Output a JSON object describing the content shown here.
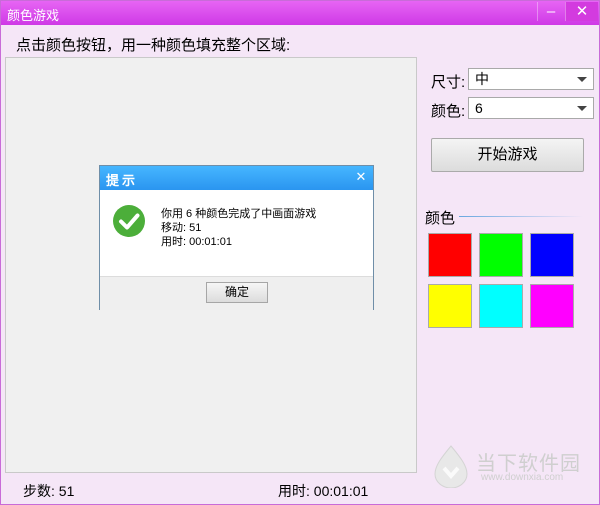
{
  "window": {
    "title": "颜色游戏"
  },
  "instruction": "点击颜色按钮，用一种颜色填充整个区域:",
  "controls": {
    "size_label": "尺寸:",
    "size_value": "中",
    "color_label": "颜色:",
    "color_value": "6",
    "start_button": "开始游戏"
  },
  "palette": {
    "title": "颜色",
    "colors": [
      "#ff0000",
      "#00ff00",
      "#0000ff",
      "#ffff00",
      "#00ffff",
      "#ff00ff"
    ]
  },
  "status": {
    "steps": "步数: 51",
    "time": "用时: 00:01:01"
  },
  "dialog": {
    "title": "提示",
    "message_line1": "你用 6 种颜色完成了中画面游戏",
    "message_line2": "移动: 51",
    "message_line3": "用时: 00:01:01",
    "ok_button": "确定"
  },
  "watermark": {
    "text": "当下软件园",
    "url": "www.downxia.com"
  },
  "colors": {
    "titlebar": "#d94ae9",
    "dialog_title": "#36a6f9",
    "success_icon": "#4cae3a"
  }
}
